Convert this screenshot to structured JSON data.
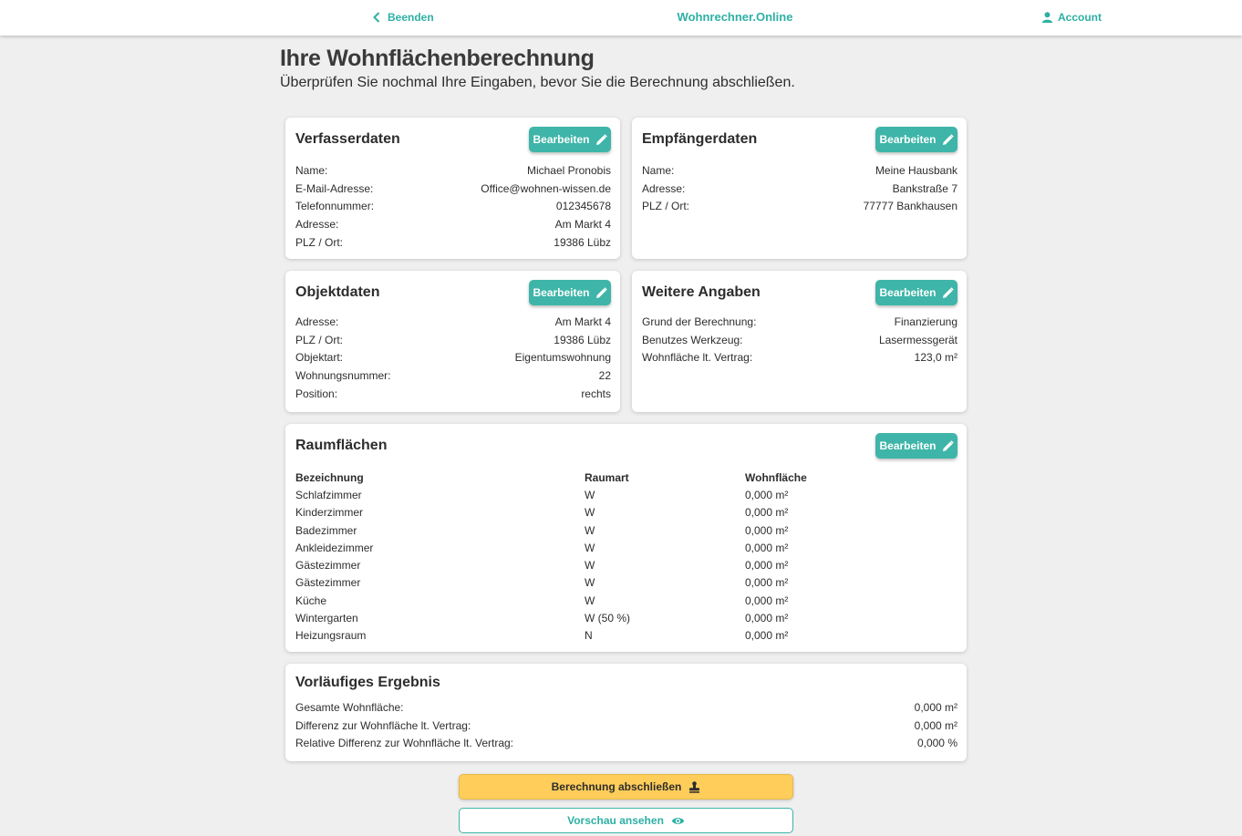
{
  "header": {
    "back_label": "Beenden",
    "brand": "Wohnrechner.Online",
    "account_label": "Account"
  },
  "page": {
    "title": "Ihre Wohnflächenberechnung",
    "subtitle": "Überprüfen Sie nochmal Ihre Eingaben, bevor Sie die Berechnung abschließen."
  },
  "edit_label": "Bearbeiten",
  "verfasser": {
    "title": "Verfasserdaten",
    "rows": [
      {
        "label": "Name:",
        "value": "Michael Pronobis"
      },
      {
        "label": "E-Mail-Adresse:",
        "value": "Office@wohnen-wissen.de"
      },
      {
        "label": "Telefonnummer:",
        "value": "012345678"
      },
      {
        "label": "Adresse:",
        "value": "Am Markt 4"
      },
      {
        "label": "PLZ / Ort:",
        "value": "19386 Lübz"
      }
    ]
  },
  "empfaenger": {
    "title": "Empfängerdaten",
    "rows": [
      {
        "label": "Name:",
        "value": "Meine Hausbank"
      },
      {
        "label": "Adresse:",
        "value": "Bankstraße 7"
      },
      {
        "label": "PLZ / Ort:",
        "value": "77777 Bankhausen"
      }
    ]
  },
  "objekt": {
    "title": "Objektdaten",
    "rows": [
      {
        "label": "Adresse:",
        "value": "Am Markt 4"
      },
      {
        "label": "PLZ / Ort:",
        "value": "19386 Lübz"
      },
      {
        "label": "Objektart:",
        "value": "Eigentumswohnung"
      },
      {
        "label": "Wohnungsnummer:",
        "value": "22"
      },
      {
        "label": "Position:",
        "value": "rechts"
      }
    ]
  },
  "weitere": {
    "title": "Weitere Angaben",
    "rows": [
      {
        "label": "Grund der Berechnung:",
        "value": "Finanzierung"
      },
      {
        "label": "Benutzes Werkzeug:",
        "value": "Lasermessgerät"
      },
      {
        "label": "Wohnfläche lt. Vertrag:",
        "value": "123,0 m²"
      }
    ]
  },
  "raum": {
    "title": "Raumflächen",
    "columns": [
      "Bezeichnung",
      "Raumart",
      "Wohnfläche"
    ],
    "rows": [
      [
        "Schlafzimmer",
        "W",
        "0,000 m²"
      ],
      [
        "Kinderzimmer",
        "W",
        "0,000 m²"
      ],
      [
        "Badezimmer",
        "W",
        "0,000 m²"
      ],
      [
        "Ankleidezimmer",
        "W",
        "0,000 m²"
      ],
      [
        "Gästezimmer",
        "W",
        "0,000 m²"
      ],
      [
        "Gästezimmer",
        "W",
        "0,000 m²"
      ],
      [
        "Küche",
        "W",
        "0,000 m²"
      ],
      [
        "Wintergarten",
        "W (50 %)",
        "0,000 m²"
      ],
      [
        "Heizungsraum",
        "N",
        "0,000 m²"
      ]
    ]
  },
  "ergebnis": {
    "title": "Vorläufiges Ergebnis",
    "rows": [
      {
        "label": "Gesamte Wohnfläche:",
        "value": "0,000 m²"
      },
      {
        "label": "Differenz zur Wohnfläche lt. Vertrag:",
        "value": "0,000 m²"
      },
      {
        "label": "Relative Differenz zur Wohnfläche lt. Vertrag:",
        "value": "0,000 %"
      }
    ]
  },
  "actions": {
    "finish_label": "Berechnung abschließen",
    "preview_label": "Vorschau ansehen"
  },
  "colors": {
    "accent": "#3eb5a8",
    "primary_action": "#ffcd5a",
    "background": "#efefef"
  }
}
